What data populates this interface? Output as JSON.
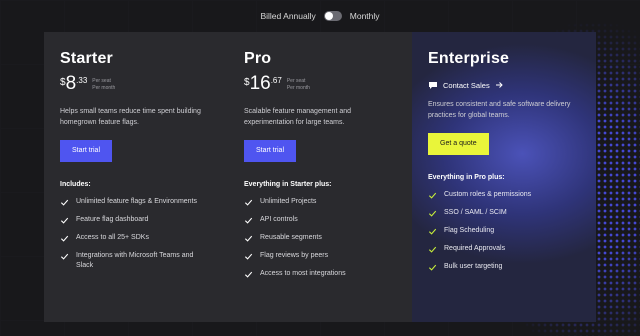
{
  "billing": {
    "annual_label": "Billed Annually",
    "monthly_label": "Monthly",
    "state": "annual"
  },
  "plans": [
    {
      "name": "Starter",
      "price_symbol": "$",
      "price_whole": "8",
      "price_cents": ".33",
      "per_line1": "Per seat",
      "per_line2": "Per month",
      "description": "Helps small teams reduce time spent building homegrown feature flags.",
      "cta": "Start trial",
      "includes_title": "Includes:",
      "features": [
        "Unlimited feature flags & Environments",
        "Feature flag dashboard",
        "Access to all 25+ SDKs",
        "Integrations with Microsoft Teams and Slack"
      ]
    },
    {
      "name": "Pro",
      "price_symbol": "$",
      "price_whole": "16",
      "price_cents": ".67",
      "per_line1": "Per seat",
      "per_line2": "Per month",
      "description": "Scalable feature management and experimentation for large teams.",
      "cta": "Start trial",
      "includes_title": "Everything in Starter plus:",
      "features": [
        "Unlimited Projects",
        "API controls",
        "Reusable segments",
        "Flag reviews by peers",
        "Access to most integrations"
      ]
    },
    {
      "name": "Enterprise",
      "contact_label": "Contact Sales",
      "description": "Ensures consistent and safe software delivery practices for global teams.",
      "cta": "Get a quote",
      "includes_title": "Everything in Pro plus:",
      "features": [
        "Custom roles & permissions",
        "SSO / SAML / SCIM",
        "Flag Scheduling",
        "Required Approvals",
        "Bulk user targeting"
      ]
    }
  ],
  "colors": {
    "accent_blue": "#4f55f0",
    "accent_yellow": "#e9f53a",
    "check_white": "#ffffff",
    "check_green": "#c8ef3a"
  },
  "icons": {
    "check": "check-icon",
    "chat": "chat-bubble-icon",
    "arrow": "arrow-right-icon"
  }
}
